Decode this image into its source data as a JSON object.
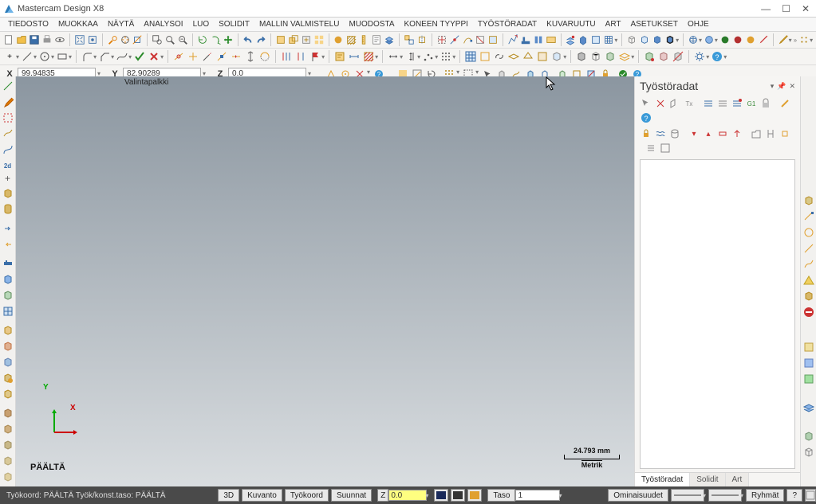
{
  "title": "Mastercam Design X8",
  "menu": [
    "TIEDOSTO",
    "MUOKKAA",
    "NÄYTÄ",
    "ANALYSOI",
    "LUO",
    "SOLIDIT",
    "MALLIN VALMISTELU",
    "MUODOSTA",
    "KONEEN TYYPPI",
    "TYÖSTÖRADAT",
    "KUVARUUTU",
    "ART",
    "ASETUKSET",
    "OHJE"
  ],
  "coords": {
    "x_label": "X",
    "x_value": "99.94835",
    "y_label": "Y",
    "y_value": "82.90289",
    "z_label": "Z",
    "z_value": "0.0"
  },
  "viewport": {
    "tab": "Valintapalkki",
    "plane": "PÄÄLTÄ",
    "scale_value": "24.793 mm",
    "scale_unit": "Metrik",
    "axis_x": "X",
    "axis_y": "Y"
  },
  "panel": {
    "title": "Työstöradat",
    "tabs": [
      "Työstöradat",
      "Solidit",
      "Art"
    ]
  },
  "status": {
    "left": "Työkoord: PÄÄLTÄ  Työk/konst.taso: PÄÄLTÄ",
    "btn_3d": "3D",
    "btn_kuvanto": "Kuvanto",
    "btn_tyokoord": "Työkoord",
    "btn_suunnat": "Suunnat",
    "z_label": "Z",
    "z_value": "0.0",
    "taso_label": "Taso",
    "taso_value": "1",
    "ominaisuudet": "Ominaisuudet",
    "ryhmat": "Ryhmät",
    "help": "?"
  },
  "colors": {
    "accent_yellow": "#ffff80",
    "axis_x": "#c00",
    "axis_y": "#0a0"
  }
}
